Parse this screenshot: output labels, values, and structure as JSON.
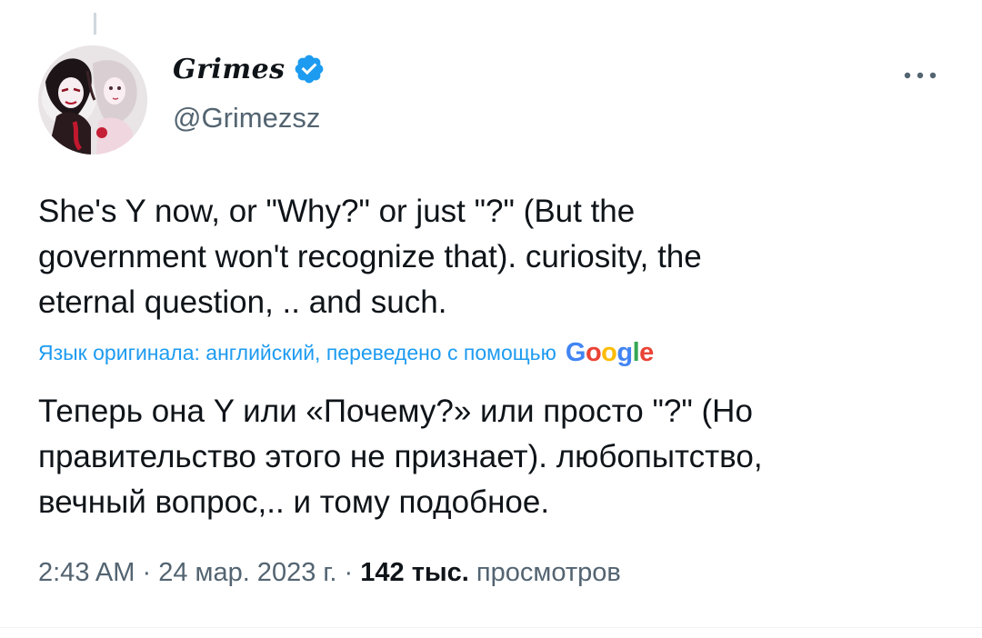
{
  "author": {
    "display_name": "Grimes",
    "handle": "@Grimezsz",
    "verified": true
  },
  "tweet": {
    "text_line1": "She's Y now, or \"Why?\" or just \"?\" (But the",
    "text_line2": "government won't recognize that).  curiosity, the",
    "text_line3": "eternal question,  .. and such."
  },
  "translation": {
    "label": "Язык оригинала: английский, переведено с помощью",
    "provider_letters": [
      "G",
      "o",
      "o",
      "g",
      "l",
      "e"
    ],
    "text_line1": "Теперь она Y или «Почему?» или просто \"?\" (Но",
    "text_line2": "правительство этого не признает). любопытство,",
    "text_line3": "вечный вопрос,.. и тому подобное."
  },
  "meta": {
    "time": "2:43 AM",
    "separator": " · ",
    "date": "24 мар. 2023 г.",
    "views_count": "142 тыс.",
    "views_label": " просмотров"
  },
  "icons": {
    "verified": "verified-badge-icon",
    "more": "more-horizontal-icon"
  },
  "colors": {
    "link": "#1d9bf0",
    "secondary_text": "#536471",
    "verified_badge": "#1d9bf0"
  }
}
